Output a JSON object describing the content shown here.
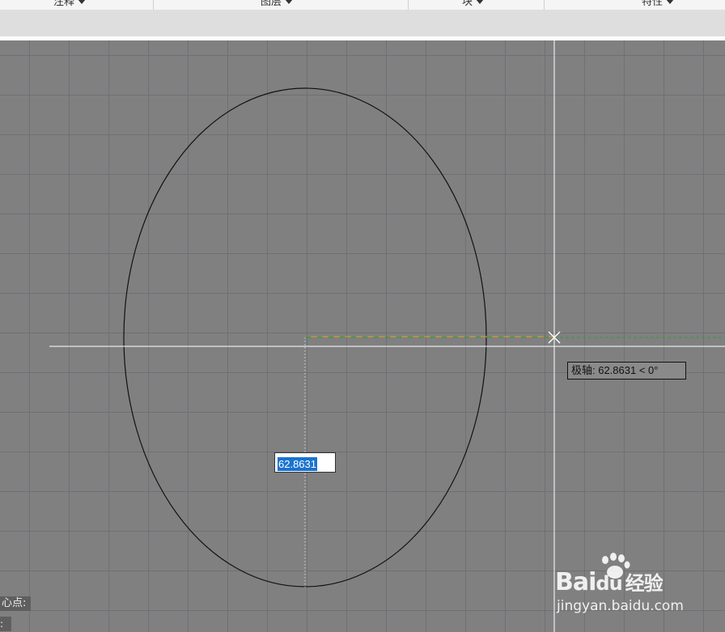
{
  "ribbon": {
    "panels": [
      {
        "label": "注释"
      },
      {
        "label": "图层"
      },
      {
        "label": "块"
      },
      {
        "label": "特性"
      }
    ]
  },
  "drawing": {
    "polar_tooltip": "极轴: 62.8631 < 0°",
    "dynamic_input_value": "62.8631"
  },
  "command_line": {
    "prompt": "心点:",
    "prompt2": ":"
  },
  "watermark": {
    "logo_text": "Bai",
    "logo_text2": "du",
    "logo_text3": "经验",
    "url": "jingyan.baidu.com"
  },
  "colors": {
    "canvas_bg": "#808080",
    "grid": "#6f6f78",
    "ellipse": "#111111",
    "crosshair": "#ffffff",
    "polar_track_orange": "#e0a020",
    "polar_track_green": "#3a9a3a",
    "selection": "#1a73d1"
  }
}
